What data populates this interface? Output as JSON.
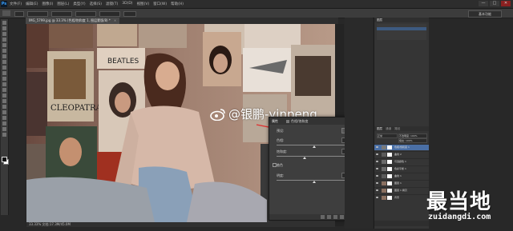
{
  "app": {
    "menu_items": [
      "文件(F)",
      "编辑(E)",
      "图像(I)",
      "图层(L)",
      "类型(Y)",
      "选择(S)",
      "滤镜(T)",
      "3D(D)",
      "视图(V)",
      "窗口(W)",
      "帮助(H)"
    ],
    "window_controls": [
      "—",
      "□",
      "✕"
    ]
  },
  "options_bar": {
    "workspace": "基本功能"
  },
  "document": {
    "tab_title": "IMG_5799.jpg @ 33.3% (色相/饱和度 1, 图层蒙版/8) *",
    "close_glyph": "×",
    "status_text": "33.33%   文档:17.3M/45.0M"
  },
  "watermark": {
    "text": "@银鹏-yinpeng",
    "icon": "weibo-icon"
  },
  "properties_dialog": {
    "title": "属性",
    "subtitle": "色相/饱和度",
    "preset_label": "预设:",
    "hue_label": "色相:",
    "hue_value": "0",
    "saturation_label": "饱和度:",
    "saturation_value": "-25",
    "lightness_label": "明度:",
    "lightness_value": "0",
    "colorize_label": "着色",
    "hue_fraction": 0.5,
    "saturation_fraction": 0.375,
    "lightness_fraction": 0.5,
    "accent_color": "#e03030"
  },
  "panels": {
    "top_tab": "图层",
    "adjust_tab": "调整",
    "layers_tab": "图层",
    "channels_tab": "通道",
    "paths_tab": "路径",
    "blend_mode": "正常",
    "opacity_label": "不透明度: 100%",
    "fill_label": "填充: 100%",
    "layers": [
      {
        "name": "色相/饱和度 1",
        "active": true,
        "thumb": "#7a7a7a"
      },
      {
        "name": "曲线 2",
        "active": false,
        "thumb": "#5a5a5a"
      },
      {
        "name": "可选颜色 1",
        "active": false,
        "thumb": "#6a6a6a"
      },
      {
        "name": "色彩平衡 1",
        "active": false,
        "thumb": "#6a6a6a"
      },
      {
        "name": "曲线 1",
        "active": false,
        "thumb": "#5a5a5a"
      },
      {
        "name": "图层 1",
        "active": false,
        "thumb": "#8a7060"
      },
      {
        "name": "图层 1 拷贝",
        "active": false,
        "thumb": "#8a7060"
      },
      {
        "name": "背景",
        "active": false,
        "thumb": "#8a7060"
      }
    ]
  },
  "site_logo": {
    "chinese": "最当地",
    "domain": "zuidangdi.com"
  }
}
